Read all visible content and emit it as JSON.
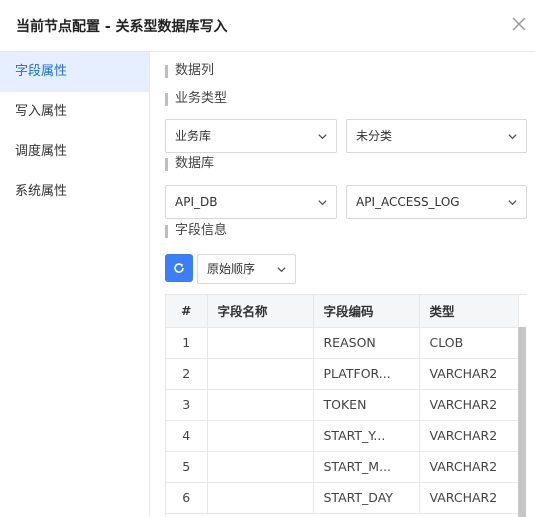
{
  "dialog": {
    "title": "当前节点配置 - 关系型数据库写入"
  },
  "sidebar": {
    "items": [
      {
        "label": "字段属性"
      },
      {
        "label": "写入属性"
      },
      {
        "label": "调度属性"
      },
      {
        "label": "系统属性"
      }
    ]
  },
  "sections": {
    "data_columns": "数据列",
    "business_type": "业务类型",
    "database": "数据库",
    "field_info": "字段信息"
  },
  "selects": {
    "business_library": "业务库",
    "category": "未分类",
    "database": "API_DB",
    "table": "API_ACCESS_LOG",
    "order": "原始顺序"
  },
  "table": {
    "headers": [
      "#",
      "字段名称",
      "字段编码",
      "类型"
    ],
    "rows": [
      {
        "num": "1",
        "name": "",
        "code": "REASON",
        "type": "CLOB"
      },
      {
        "num": "2",
        "name": "",
        "code": "PLATFOR...",
        "type": "VARCHAR2"
      },
      {
        "num": "3",
        "name": "",
        "code": "TOKEN",
        "type": "VARCHAR2"
      },
      {
        "num": "4",
        "name": "",
        "code": "START_Y...",
        "type": "VARCHAR2"
      },
      {
        "num": "5",
        "name": "",
        "code": "START_M...",
        "type": "VARCHAR2"
      },
      {
        "num": "6",
        "name": "",
        "code": "START_DAY",
        "type": "VARCHAR2"
      }
    ]
  },
  "colors": {
    "accent": "#3b7ef6",
    "active_bg": "#e6efff",
    "active_text": "#1f6fe0"
  }
}
